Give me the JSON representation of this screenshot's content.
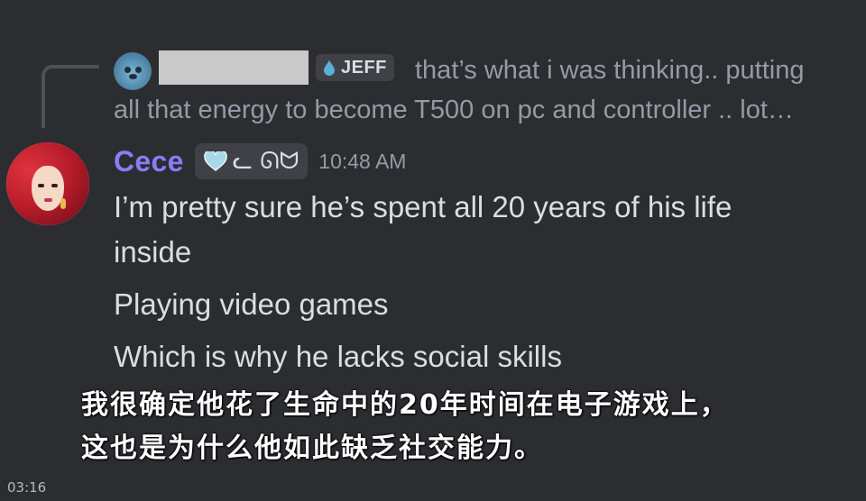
{
  "reply": {
    "tag_label": "JEFF",
    "text_line_1": "that’s what i was thinking.. putting",
    "text_line_2": "all that energy to become T500 on pc and controller .. lot…",
    "tag_icon": "water-drop-icon"
  },
  "message": {
    "author": "Cece",
    "tag_label": "ᓚ ᘏᗢ",
    "tag_icon": "heart-icon",
    "timestamp": "10:48 AM",
    "lines": [
      "I’m pretty sure he’s spent all 20 years of his life",
      "inside",
      "Playing video games",
      "Which is why he lacks social skills"
    ]
  },
  "subtitles": {
    "line_1": "我很确定他花了生命中的20年时间在电子游戏上，",
    "line_2": "这也是为什么他如此缺乏社交能力。"
  },
  "video": {
    "time": "03:16"
  },
  "colors": {
    "background": "#2b2d31",
    "author": "#8b7cf8",
    "body_text": "#dbdee1",
    "muted_text": "#949ba4",
    "tag_bg": "#3f4147",
    "drop_icon": "#5ab0d8",
    "heart_icon": "#a8d8e8"
  }
}
